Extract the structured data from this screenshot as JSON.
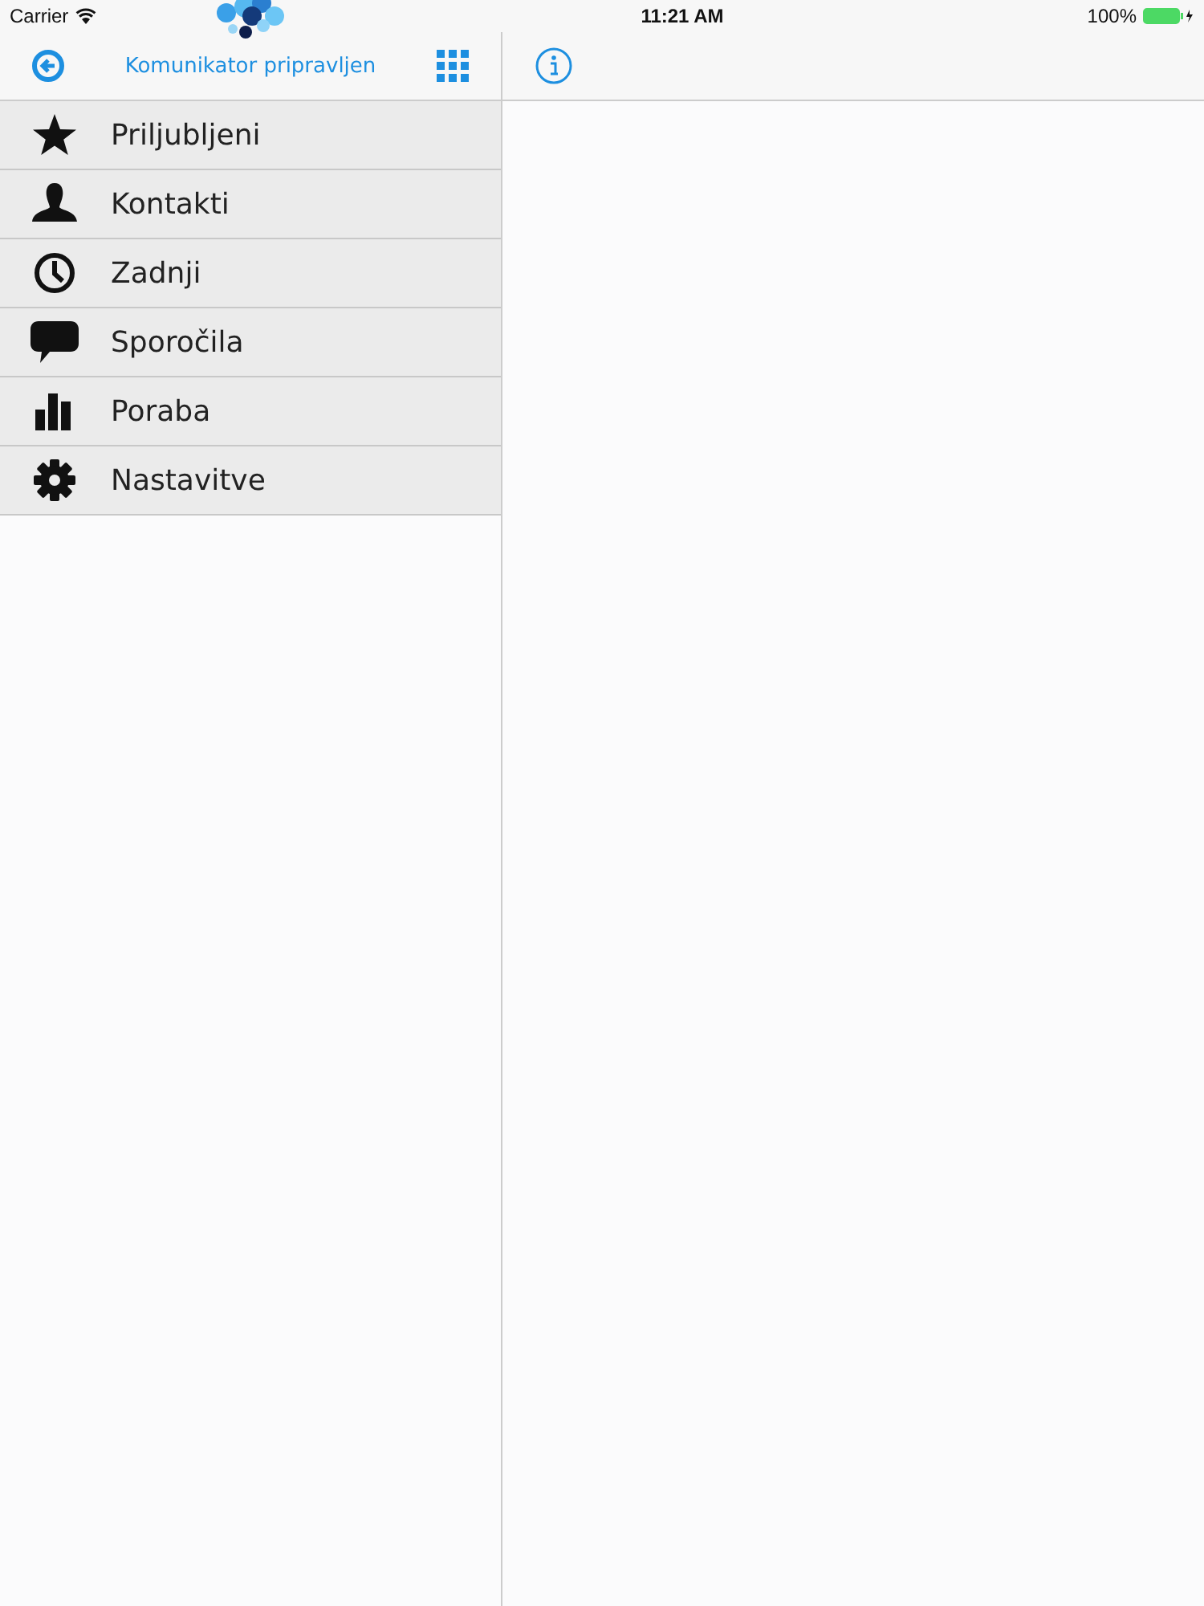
{
  "status_bar": {
    "carrier": "Carrier",
    "time": "11:21 AM",
    "battery": "100%"
  },
  "sidebar": {
    "title": "Komunikator pripravljen",
    "items": [
      {
        "kind": "star",
        "label": "Priljubljeni"
      },
      {
        "kind": "person",
        "label": "Kontakti"
      },
      {
        "kind": "clock",
        "label": "Zadnji"
      },
      {
        "kind": "chat",
        "label": "Sporočila"
      },
      {
        "kind": "chart",
        "label": "Poraba"
      },
      {
        "kind": "gear",
        "label": "Nastavitve"
      }
    ]
  }
}
